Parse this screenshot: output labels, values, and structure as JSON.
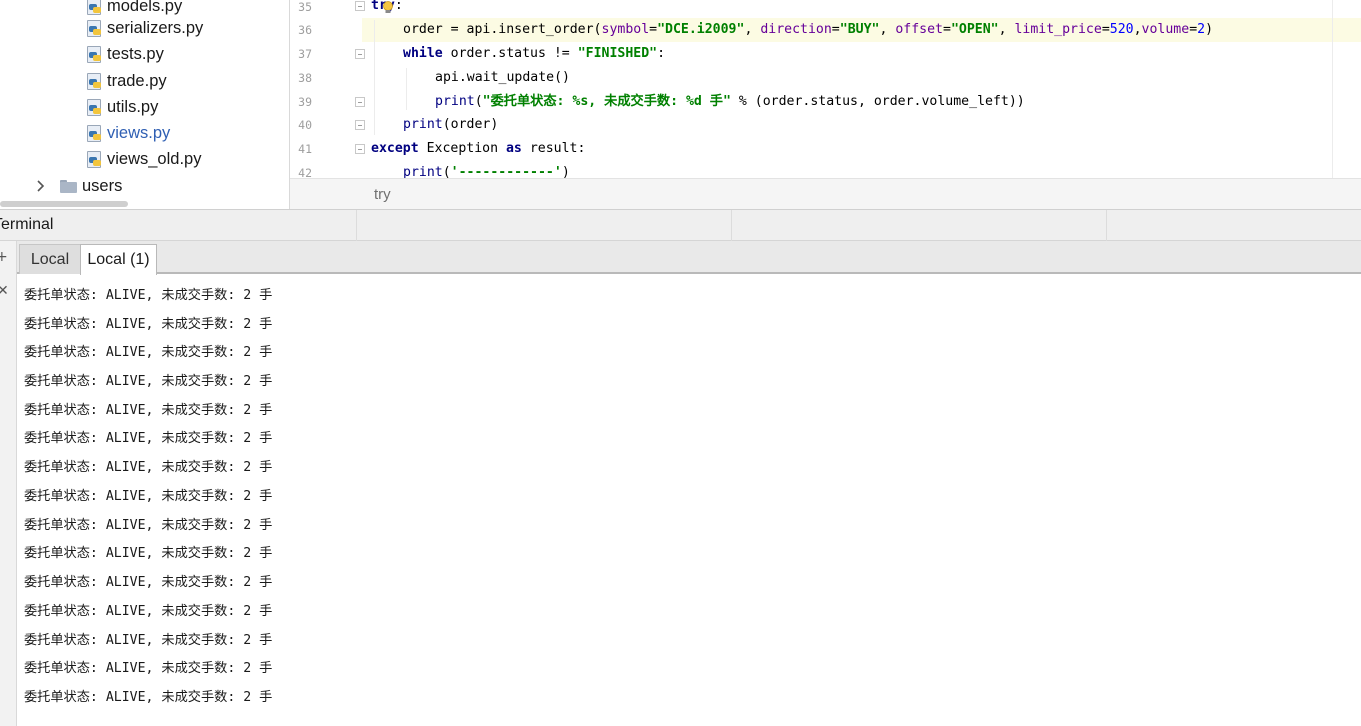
{
  "project_tree": {
    "items": [
      {
        "label": "models.py",
        "type": "file",
        "active": false
      },
      {
        "label": "serializers.py",
        "type": "file",
        "active": false
      },
      {
        "label": "tests.py",
        "type": "file",
        "active": false
      },
      {
        "label": "trade.py",
        "type": "file",
        "active": false
      },
      {
        "label": "utils.py",
        "type": "file",
        "active": false
      },
      {
        "label": "views.py",
        "type": "file",
        "active": true
      },
      {
        "label": "views_old.py",
        "type": "file",
        "active": false
      },
      {
        "label": "users",
        "type": "folder",
        "active": false
      }
    ]
  },
  "editor": {
    "line_numbers": [
      "35",
      "36",
      "37",
      "38",
      "39",
      "40",
      "41",
      "42"
    ],
    "code": {
      "l35_kw": "try",
      "l35_rest": ":",
      "l36_a": "order = api.insert_order(",
      "l36_p1": "symbol",
      "l36_eq1": "=",
      "l36_s1": "\"DCE.i2009\"",
      "l36_c1": ", ",
      "l36_p2": "direction",
      "l36_eq2": "=",
      "l36_s2": "\"BUY\"",
      "l36_c2": ", ",
      "l36_p3": "offset",
      "l36_eq3": "=",
      "l36_s3": "\"OPEN\"",
      "l36_c3": ", ",
      "l36_p4": "limit_price",
      "l36_eq4": "=",
      "l36_n4": "520",
      "l36_c4": ",",
      "l36_p5": "volume",
      "l36_eq5": "=",
      "l36_n5": "2",
      "l36_end": ")",
      "l37_kw": "while",
      "l37_mid": " order.status != ",
      "l37_s": "\"FINISHED\"",
      "l37_end": ":",
      "l38": "api.wait_update()",
      "l39_fn": "print",
      "l39_open": "(",
      "l39_s": "\"委托单状态: %s, 未成交手数: %d 手\"",
      "l39_rest": " % (order.status, order.volume_left))",
      "l40_fn": "print",
      "l40_rest": "(order)",
      "l41_kw1": "except",
      "l41_mid": " Exception ",
      "l41_kw2": "as",
      "l41_rest": " result:",
      "l42_fn": "print",
      "l42_open": "(",
      "l42_s": "'------------'",
      "l42_end": ")"
    },
    "breadcrumb": "try"
  },
  "terminal": {
    "title": "Terminal",
    "tabs": [
      {
        "label": "Local",
        "active": false
      },
      {
        "label": "Local (1)",
        "active": true
      }
    ],
    "toolbar_icons": [
      "add-icon",
      "close-icon"
    ],
    "output_lines": [
      "委托单状态: ALIVE, 未成交手数: 2 手",
      "委托单状态: ALIVE, 未成交手数: 2 手",
      "委托单状态: ALIVE, 未成交手数: 2 手",
      "委托单状态: ALIVE, 未成交手数: 2 手",
      "委托单状态: ALIVE, 未成交手数: 2 手",
      "委托单状态: ALIVE, 未成交手数: 2 手",
      "委托单状态: ALIVE, 未成交手数: 2 手",
      "委托单状态: ALIVE, 未成交手数: 2 手",
      "委托单状态: ALIVE, 未成交手数: 2 手",
      "委托单状态: ALIVE, 未成交手数: 2 手",
      "委托单状态: ALIVE, 未成交手数: 2 手",
      "委托单状态: ALIVE, 未成交手数: 2 手",
      "委托单状态: ALIVE, 未成交手数: 2 手",
      "委托单状态: ALIVE, 未成交手数: 2 手",
      "委托单状态: ALIVE, 未成交手数: 2 手"
    ]
  }
}
